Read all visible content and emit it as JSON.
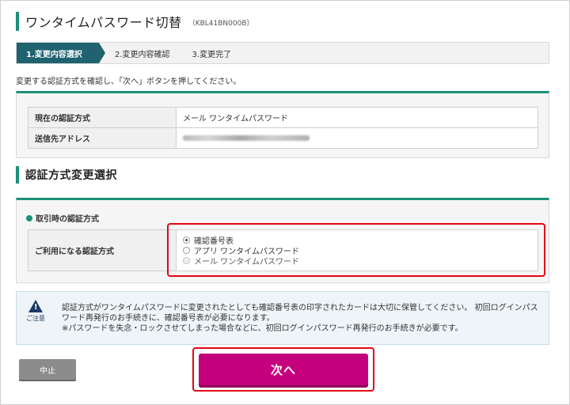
{
  "header": {
    "title": "ワンタイムパスワード切替",
    "code": "（KBL41BN000B）"
  },
  "steps": [
    {
      "label": "1.変更内容選択",
      "active": true
    },
    {
      "label": "2.変更内容確認",
      "active": false
    },
    {
      "label": "3.変更完了",
      "active": false
    }
  ],
  "instruction": "変更する認証方式を確認し、「次へ」ボタンを押してください。",
  "current_info": {
    "rows": [
      {
        "label": "現在の認証方式",
        "value": "メール ワンタイムパスワード"
      },
      {
        "label": "送信先アドレス",
        "value": "",
        "value_obscured": true
      }
    ]
  },
  "section": {
    "title": "認証方式変更選択",
    "subheading": "取引時の認証方式",
    "row_label": "ご利用になる認証方式",
    "options": [
      {
        "label": "確認番号表",
        "checked": true,
        "disabled": false
      },
      {
        "label": "アプリ ワンタイムパスワード",
        "checked": false,
        "disabled": false
      },
      {
        "label": "メール ワンタイムパスワード",
        "checked": false,
        "disabled": true
      }
    ]
  },
  "notice": {
    "icon_label": "ご注意",
    "lines": [
      "認証方式がワンタイムパスワードに変更されたとしても確認番号表の印字されたカードは大切に保管してください。 初回ログインパス",
      "ワード再発行のお手続きに、確認番号表が必要になります。",
      "※パスワードを失念・ロックさせてしまった場合などに、初回ログインパスワード再発行のお手続きが必要です。"
    ]
  },
  "buttons": {
    "cancel": "中止",
    "next": "次へ"
  },
  "colors": {
    "accent": "#1a9179",
    "step_active": "#20626f",
    "next_button": "#c5007c",
    "highlight": "#e30613"
  }
}
